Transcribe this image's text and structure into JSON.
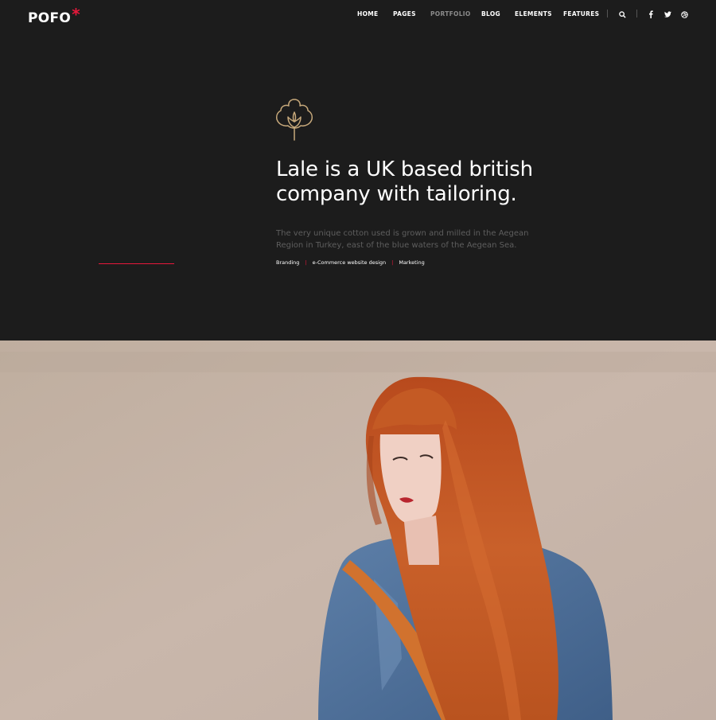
{
  "header": {
    "logo_text": "POFO",
    "logo_mark": "*",
    "nav": [
      "HOME",
      "PAGES",
      "PORTFOLIO",
      "BLOG",
      "ELEMENTS",
      "FEATURES"
    ],
    "active_nav": "PORTFOLIO",
    "icons": [
      "search-icon",
      "facebook-icon",
      "twitter-icon",
      "dribbble-icon"
    ]
  },
  "hero": {
    "title_line1": "Lale is a UK based british",
    "title_line2": "company with tailoring.",
    "desc_line1": "The very unique cotton used is grown and milled in the Aegean",
    "desc_line2": "Region in Turkey, east of the blue waters of the Aegean Sea.",
    "tags": [
      "Branding",
      "e-Commerce website design",
      "Marketing"
    ]
  },
  "colors": {
    "background": "#1c1c1c",
    "accent": "#e8183b",
    "icon_gold": "#c7a97b",
    "photo_bg": "#c5b3a6",
    "hair": "#c2521f"
  }
}
